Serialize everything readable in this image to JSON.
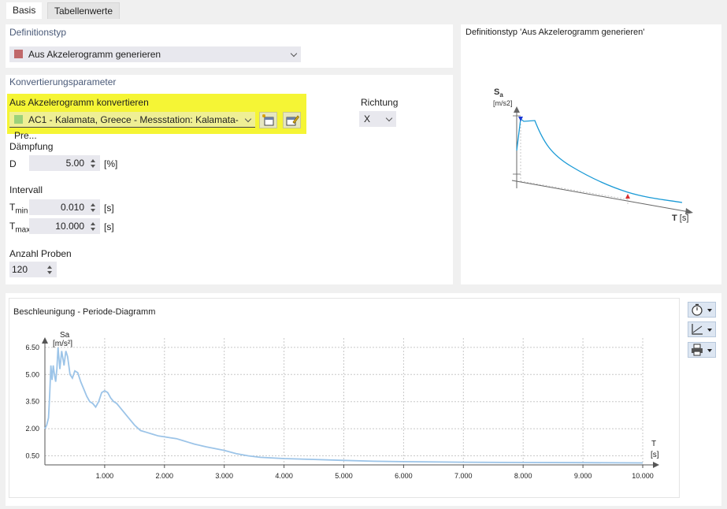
{
  "tabs": [
    {
      "label": "Basis"
    },
    {
      "label": "Tabellenwerte"
    }
  ],
  "definition": {
    "title": "Definitionstyp",
    "selected": "Aus Akzelerogramm generieren",
    "swatch_color": "#c0686a"
  },
  "conversion": {
    "title": "Konvertierungsparameter",
    "accelerogram_label": "Aus Akzelerogramm konvertieren",
    "accelerogram_value": "AC1 - Kalamata, Greece - Messstation: Kalamata-Pre...",
    "swatch_color": "#9cd27a",
    "highlight_color": "#f5f535",
    "direction_label": "Richtung",
    "direction_value": "X",
    "damping_title": "Dämpfung",
    "damping_symbol": "D",
    "damping_value": "5.00",
    "damping_unit": "[%]",
    "interval_title": "Intervall",
    "tmin_symbol": "T",
    "tmin_sub": "min",
    "tmin_value": "0.010",
    "tmin_unit": "[s]",
    "tmax_symbol": "T",
    "tmax_sub": "max",
    "tmax_value": "10.000",
    "tmax_unit": "[s]",
    "samples_title": "Anzahl Proben",
    "samples_value": "120"
  },
  "preview": {
    "title": "Definitionstyp 'Aus Akzelerogramm generieren'",
    "y_symbol": "S",
    "y_sub": "a",
    "y_unit": "[m/s2]",
    "x_symbol": "T",
    "x_unit": "[s]",
    "curve_color": "#1a9ad6"
  },
  "diagram": {
    "title": "Beschleunigung - Periode-Diagramm",
    "y_label": "Sa",
    "y_unit": "[m/s²]",
    "x_label": "T",
    "x_unit": "[s]"
  },
  "chart_data": {
    "type": "line",
    "title": "Beschleunigung - Periode-Diagramm",
    "xlabel": "T [s]",
    "ylabel": "Sa [m/s²]",
    "xlim": [
      0,
      10
    ],
    "ylim": [
      0,
      6.8
    ],
    "x_ticks": [
      "1.000",
      "2.000",
      "3.000",
      "4.000",
      "5.000",
      "6.000",
      "7.000",
      "8.000",
      "9.000",
      "10.000"
    ],
    "x_tick_values": [
      1,
      2,
      3,
      4,
      5,
      6,
      7,
      8,
      9,
      10
    ],
    "y_ticks": [
      "0.50",
      "2.00",
      "3.50",
      "5.00",
      "6.50"
    ],
    "y_tick_values": [
      0.5,
      2.0,
      3.5,
      5.0,
      6.5
    ],
    "grid": true,
    "series_color": "#9cc4e8",
    "x": [
      0.0,
      0.03,
      0.06,
      0.08,
      0.1,
      0.12,
      0.14,
      0.16,
      0.18,
      0.2,
      0.22,
      0.25,
      0.28,
      0.3,
      0.32,
      0.35,
      0.38,
      0.42,
      0.46,
      0.5,
      0.55,
      0.6,
      0.65,
      0.7,
      0.75,
      0.8,
      0.85,
      0.9,
      0.95,
      1.0,
      1.05,
      1.1,
      1.15,
      1.2,
      1.25,
      1.3,
      1.4,
      1.5,
      1.6,
      1.7,
      1.8,
      1.9,
      2.0,
      2.1,
      2.2,
      2.3,
      2.4,
      2.5,
      2.7,
      3.0,
      3.2,
      3.4,
      3.6,
      4.0,
      4.5,
      5.0,
      5.5,
      6.0,
      7.0,
      8.0,
      9.0,
      10.0
    ],
    "y": [
      2.0,
      2.2,
      2.6,
      3.9,
      5.5,
      4.7,
      5.5,
      5.0,
      4.6,
      5.3,
      6.5,
      5.3,
      6.3,
      5.9,
      5.5,
      6.3,
      6.0,
      5.0,
      4.8,
      5.2,
      5.1,
      4.6,
      4.2,
      3.8,
      3.5,
      3.4,
      3.2,
      3.5,
      4.0,
      4.1,
      4.0,
      3.7,
      3.5,
      3.4,
      3.2,
      3.0,
      2.6,
      2.2,
      1.9,
      1.8,
      1.7,
      1.6,
      1.55,
      1.5,
      1.45,
      1.35,
      1.25,
      1.15,
      1.0,
      0.8,
      0.62,
      0.5,
      0.42,
      0.35,
      0.3,
      0.25,
      0.2,
      0.18,
      0.15,
      0.13,
      0.12,
      0.11
    ]
  }
}
